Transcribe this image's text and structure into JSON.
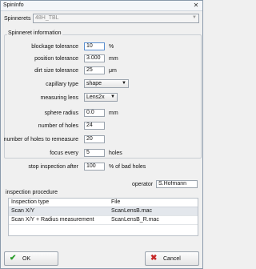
{
  "window": {
    "title": "SpinInfo",
    "close_glyph": "✕"
  },
  "spinnerets": {
    "label": "Spinnerets",
    "value": "48H_TBL"
  },
  "spinneret_info": {
    "title": "Spinneret information",
    "blockage_tolerance": {
      "label": "blockage tolerance",
      "value": "10",
      "unit": "%"
    },
    "position_tolerance": {
      "label": "position tolerance",
      "value": "3.000",
      "unit": "mm"
    },
    "dirt_size_tolerance": {
      "label": "dirt size tolerance",
      "value": "25",
      "unit": "μm"
    },
    "capillary_type": {
      "label": "capillary type",
      "value": "shape"
    },
    "measuring_lens": {
      "label": "measuring lens",
      "value": "Lens2x"
    },
    "sphere_radius": {
      "label": "sphere radius",
      "value": "0.0",
      "unit": "mm"
    },
    "number_of_holes": {
      "label": "number of holes",
      "value": "24"
    },
    "number_of_holes_remeasure": {
      "label": "number of holes to remeasure",
      "value": "20"
    },
    "focus_every": {
      "label": "focus every",
      "value": "5",
      "unit": "holes"
    },
    "stop_inspection_after": {
      "label": "stop inspection after",
      "value": "100",
      "unit": "% of bad holes"
    }
  },
  "operator": {
    "label": "operator",
    "value": "S.Hofmann"
  },
  "inspection_procedure": {
    "title": "inspection procedure",
    "columns": [
      "Inspection type",
      "File"
    ],
    "rows": [
      {
        "type": "Scan X/Y",
        "file": "ScanLensB.mac"
      },
      {
        "type": "Scan X/Y + Radius measurement",
        "file": "ScanLensB_R.mac"
      }
    ]
  },
  "buttons": {
    "ok": "OK",
    "cancel": "Cancel"
  },
  "icons": {
    "ok": "check-icon",
    "cancel": "cancel-x-icon",
    "dropdown": "chevron-down-icon"
  },
  "colors": {
    "ok_icon": "#2a9d2a",
    "cancel_icon": "#c62828",
    "accent": "#3a6ea5"
  }
}
